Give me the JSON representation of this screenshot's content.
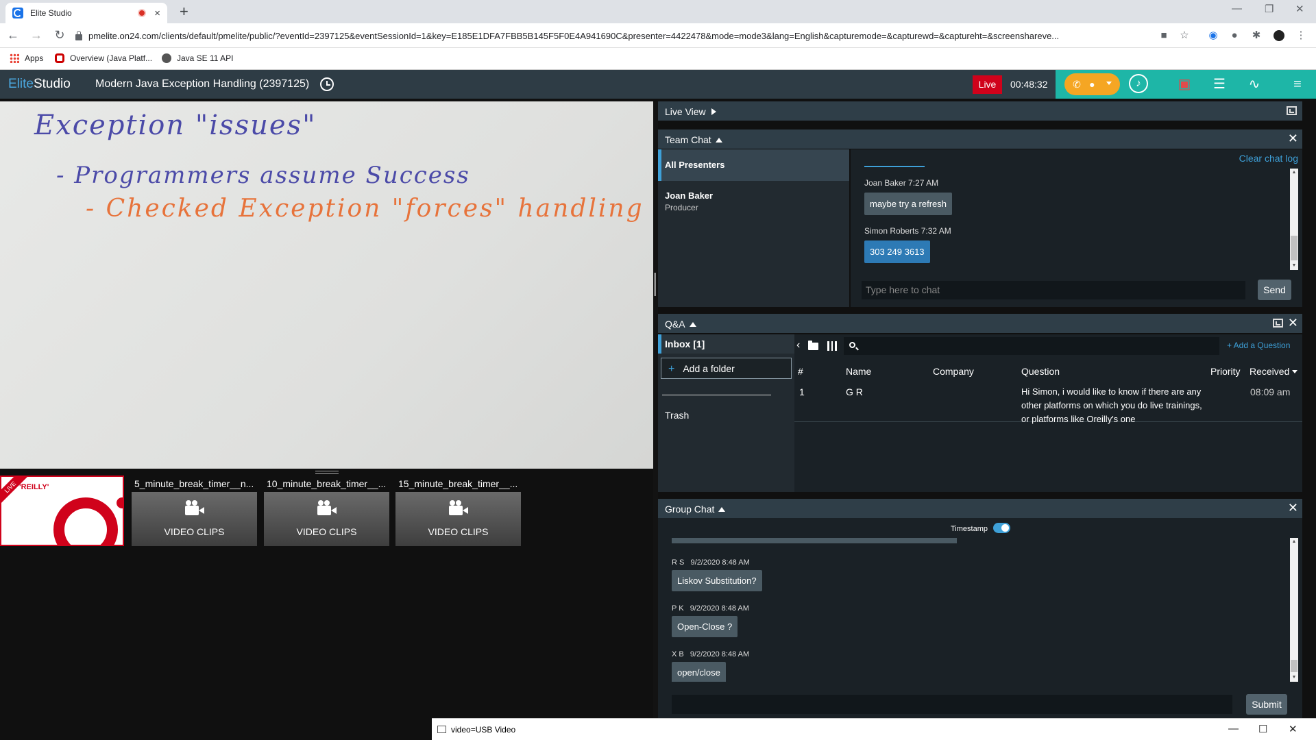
{
  "browser": {
    "tab_title": "Elite Studio",
    "tab_close": "×",
    "new_tab": "+",
    "window_controls": {
      "minimize": "—",
      "restore": "❐",
      "close": "✕"
    },
    "url": "pmelite.on24.com/clients/default/pmelite/public/?eventId=2397125&eventSessionId=1&key=E185E1DFA7FBB5B145F5F0E4A941690C&presenter=4422478&mode=mode3&lang=English&capturemode=&capturewd=&captureht=&screenshareve...",
    "bookmarks": [
      "Apps",
      "Overview (Java Platf...",
      "Java SE 11 API"
    ]
  },
  "app": {
    "logo_part1": "Elite",
    "logo_part2": "Studio",
    "event_title": "Modern Java Exception Handling (2397125)",
    "live_label": "Live",
    "timer": "00:48:32",
    "accent_color": "#1eb6a7",
    "live_color": "#d0021b"
  },
  "stage": {
    "whiteboard": {
      "line1": "Exception \"issues\"",
      "line2": "- Programmers assume Success",
      "line3": "- Checked Exception \"forces\" handling"
    },
    "live_thumb": {
      "ribbon": "LIVE",
      "brand": "'REILLY'"
    },
    "clips": [
      {
        "title": "5_minute_break_timer__n...",
        "label": "VIDEO CLIPS"
      },
      {
        "title": "10_minute_break_timer__...",
        "label": "VIDEO CLIPS"
      },
      {
        "title": "15_minute_break_timer__...",
        "label": "VIDEO CLIPS"
      }
    ]
  },
  "live_view": {
    "label": "Live View"
  },
  "team_chat": {
    "label": "Team Chat",
    "channels": [
      {
        "label": "All Presenters"
      }
    ],
    "person": {
      "name": "Joan Baker",
      "role": "Producer"
    },
    "clear_log": "Clear chat log",
    "messages": [
      {
        "meta": "Joan Baker  7:27 AM",
        "text": "maybe try a refresh"
      },
      {
        "meta": "Simon Roberts  7:32 AM",
        "text": "303 249 3613"
      }
    ],
    "input_placeholder": "Type here to chat",
    "send_label": "Send"
  },
  "qa": {
    "label": "Q&A",
    "inbox": "Inbox [1]",
    "add_folder": "Add a folder",
    "trash": "Trash",
    "add_question": "+ Add a Question",
    "columns": [
      "#",
      "Name",
      "Company",
      "Question",
      "Priority",
      "Received"
    ],
    "rows": [
      {
        "num": "1",
        "name": "G R",
        "company": "",
        "question": "Hi Simon, i would like to know if there are any other platforms on which you do live trainings, or platforms like Oreilly's one",
        "priority": "",
        "received": "08:09 am"
      }
    ]
  },
  "group_chat": {
    "label": "Group Chat",
    "timestamp_label": "Timestamp",
    "messages": [
      {
        "author": "R S",
        "time": "9/2/2020 8:48 AM",
        "text": "Liskov Substitution?"
      },
      {
        "author": "P K",
        "time": "9/2/2020 8:48 AM",
        "text": "Open-Close ?"
      },
      {
        "author": "X B",
        "time": "9/2/2020 8:48 AM",
        "text": "open/close"
      }
    ],
    "submit_label": "Submit"
  },
  "usb_window": {
    "title": "video=USB Video",
    "controls": {
      "minimize": "—",
      "maximize": "☐",
      "close": "✕"
    }
  }
}
